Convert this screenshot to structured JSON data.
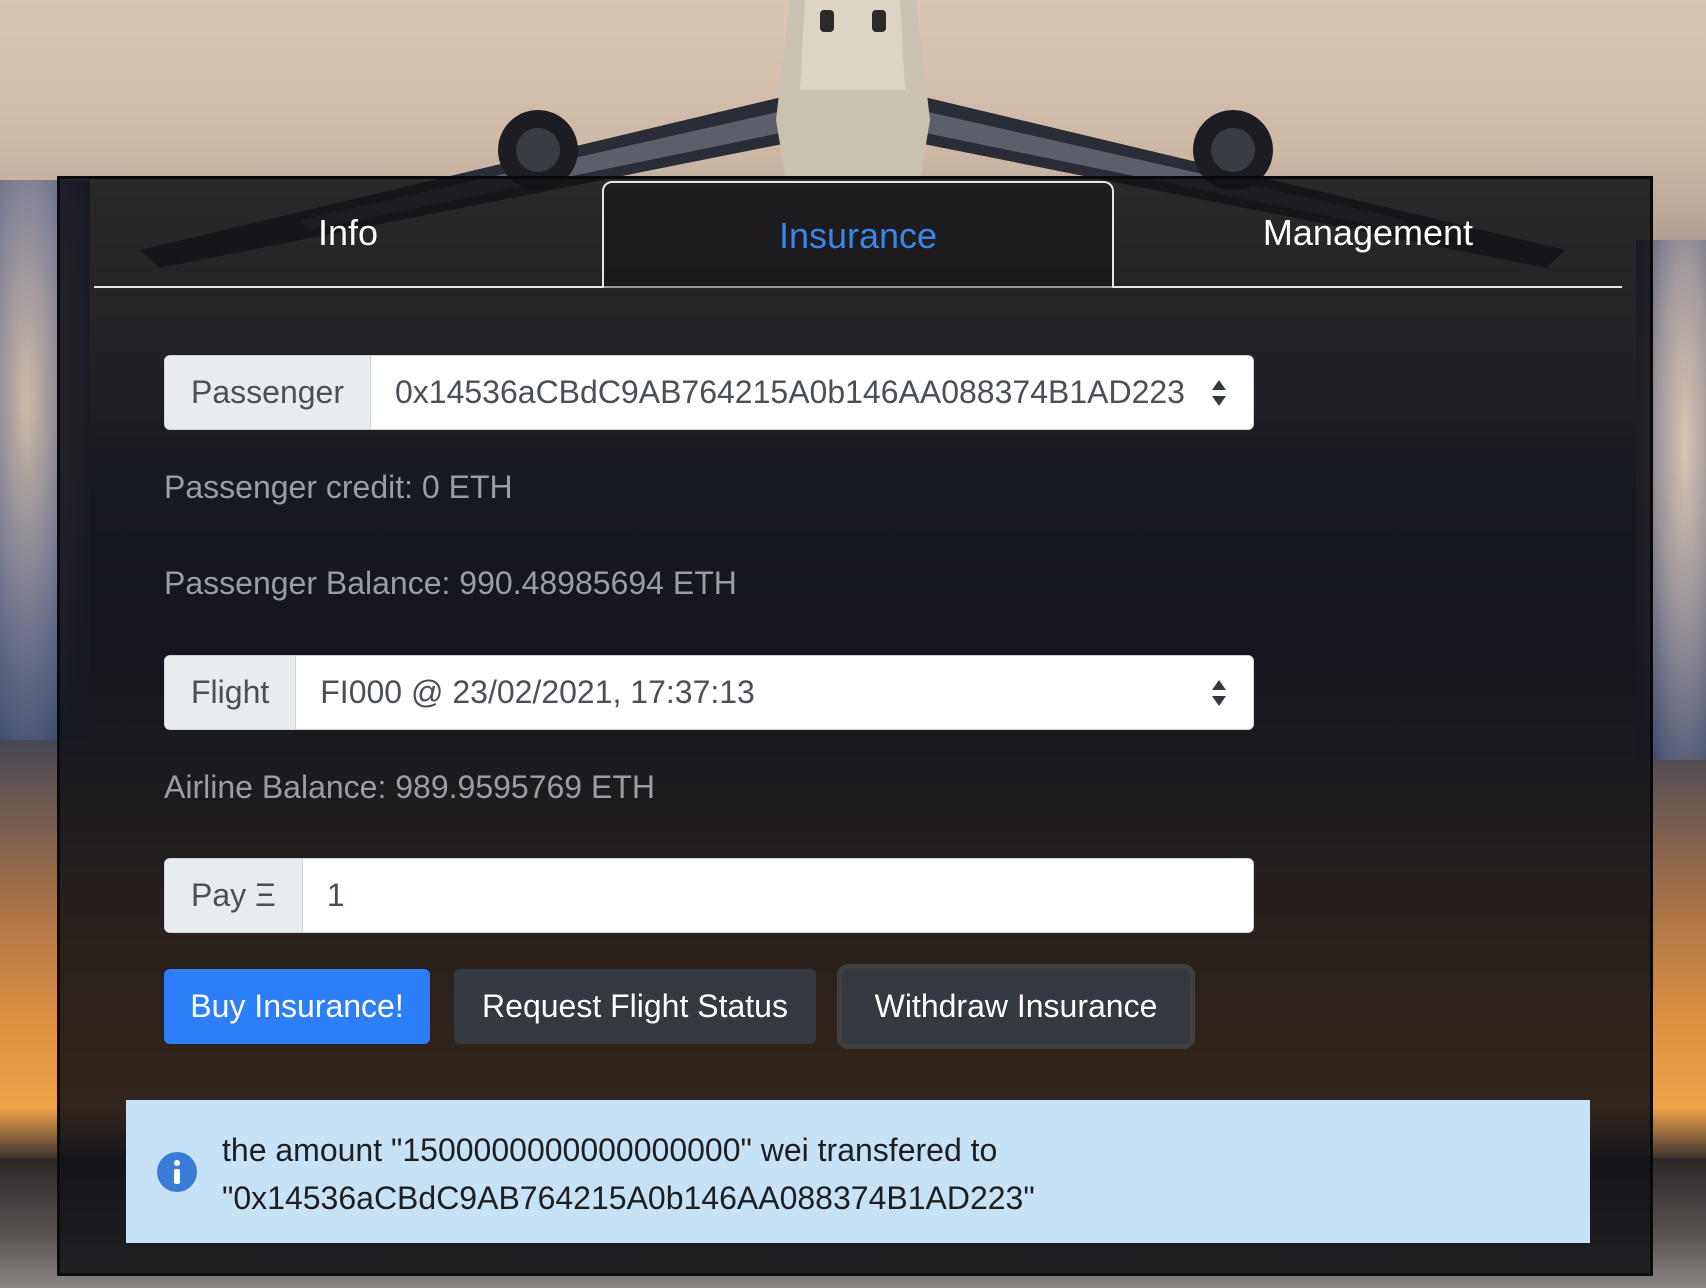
{
  "tabs": {
    "info": "Info",
    "insurance": "Insurance",
    "management": "Management"
  },
  "passenger": {
    "label": "Passenger",
    "selected": "0x14536aCBdC9AB764215A0b146AA088374B1AD223",
    "credit": "Passenger credit: 0 ETH",
    "balance": "Passenger Balance: 990.48985694 ETH"
  },
  "flight": {
    "label": "Flight",
    "selected": "FI000 @ 23/02/2021, 17:37:13",
    "airline_balance": "Airline Balance: 989.9595769 ETH"
  },
  "pay": {
    "label": "Pay Ξ",
    "value": "1"
  },
  "buttons": {
    "buy": "Buy Insurance!",
    "request_status": "Request Flight Status",
    "withdraw": "Withdraw Insurance"
  },
  "alert": {
    "line1": "the amount \"1500000000000000000\" wei transfered to",
    "line2": "\"0x14536aCBdC9AB764215A0b146AA088374B1AD223\"",
    "icon": "info-circle-icon"
  },
  "colors": {
    "accent": "#3a86e8",
    "primary_button": "#2d7ff9",
    "dark_button": "#343a40",
    "alert_bg": "#c6e2f7"
  }
}
